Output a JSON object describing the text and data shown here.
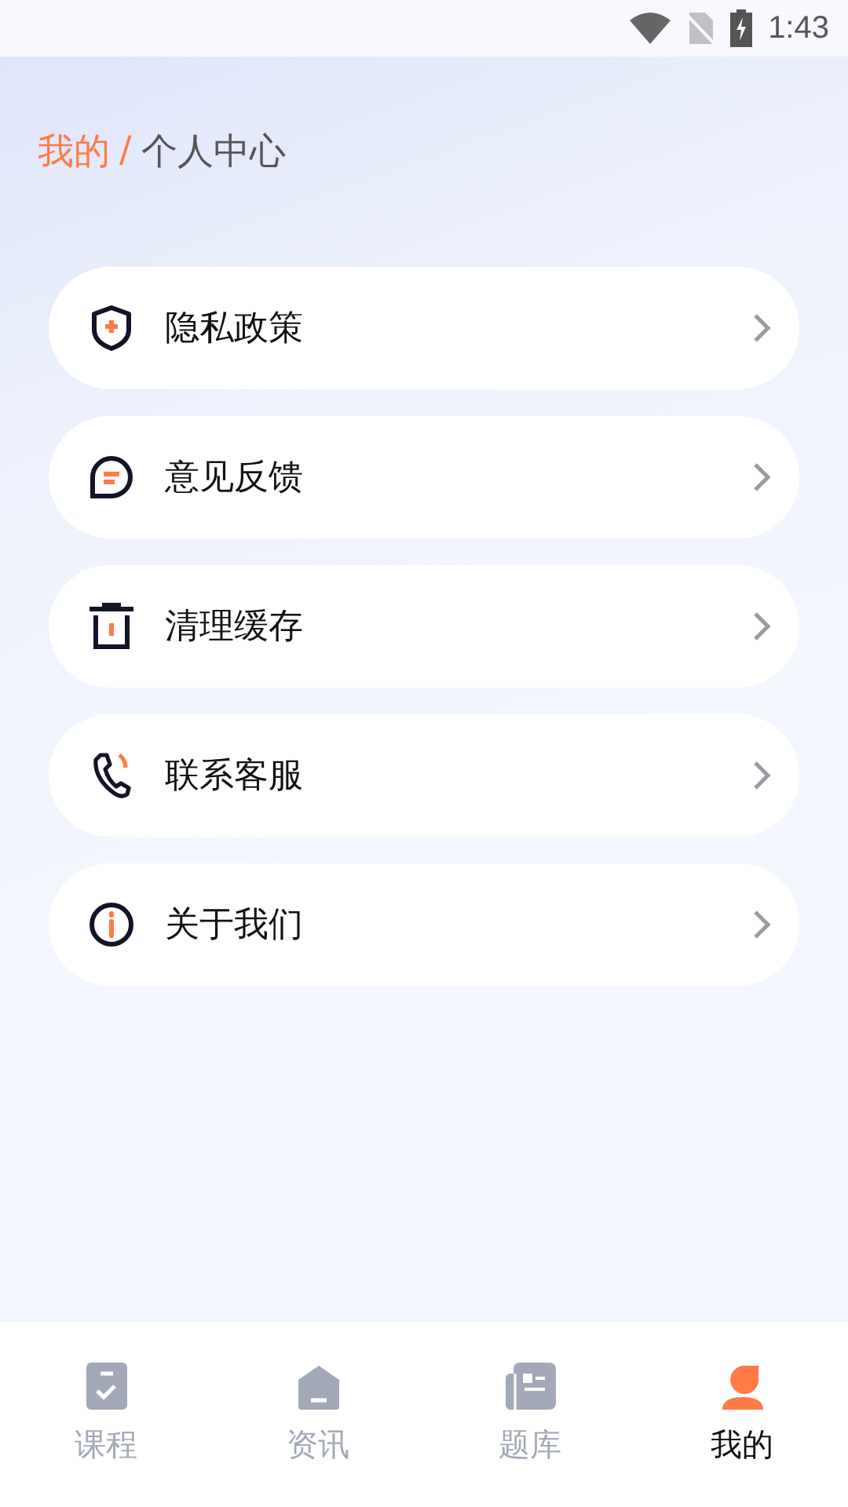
{
  "status_bar": {
    "time": "1:43"
  },
  "breadcrumb": {
    "parent": "我的",
    "separator": "/",
    "current": "个人中心"
  },
  "menu": [
    {
      "kind": "shield",
      "label": "隐私政策"
    },
    {
      "kind": "chat",
      "label": "意见反馈"
    },
    {
      "kind": "trash",
      "label": "清理缓存"
    },
    {
      "kind": "phone",
      "label": "联系客服"
    },
    {
      "kind": "info",
      "label": "关于我们"
    }
  ],
  "tabs": [
    {
      "kind": "course",
      "label": "课程",
      "selected": false
    },
    {
      "kind": "news",
      "label": "资讯",
      "selected": false
    },
    {
      "kind": "bank",
      "label": "题库",
      "selected": false
    },
    {
      "kind": "me",
      "label": "我的",
      "selected": true
    }
  ]
}
